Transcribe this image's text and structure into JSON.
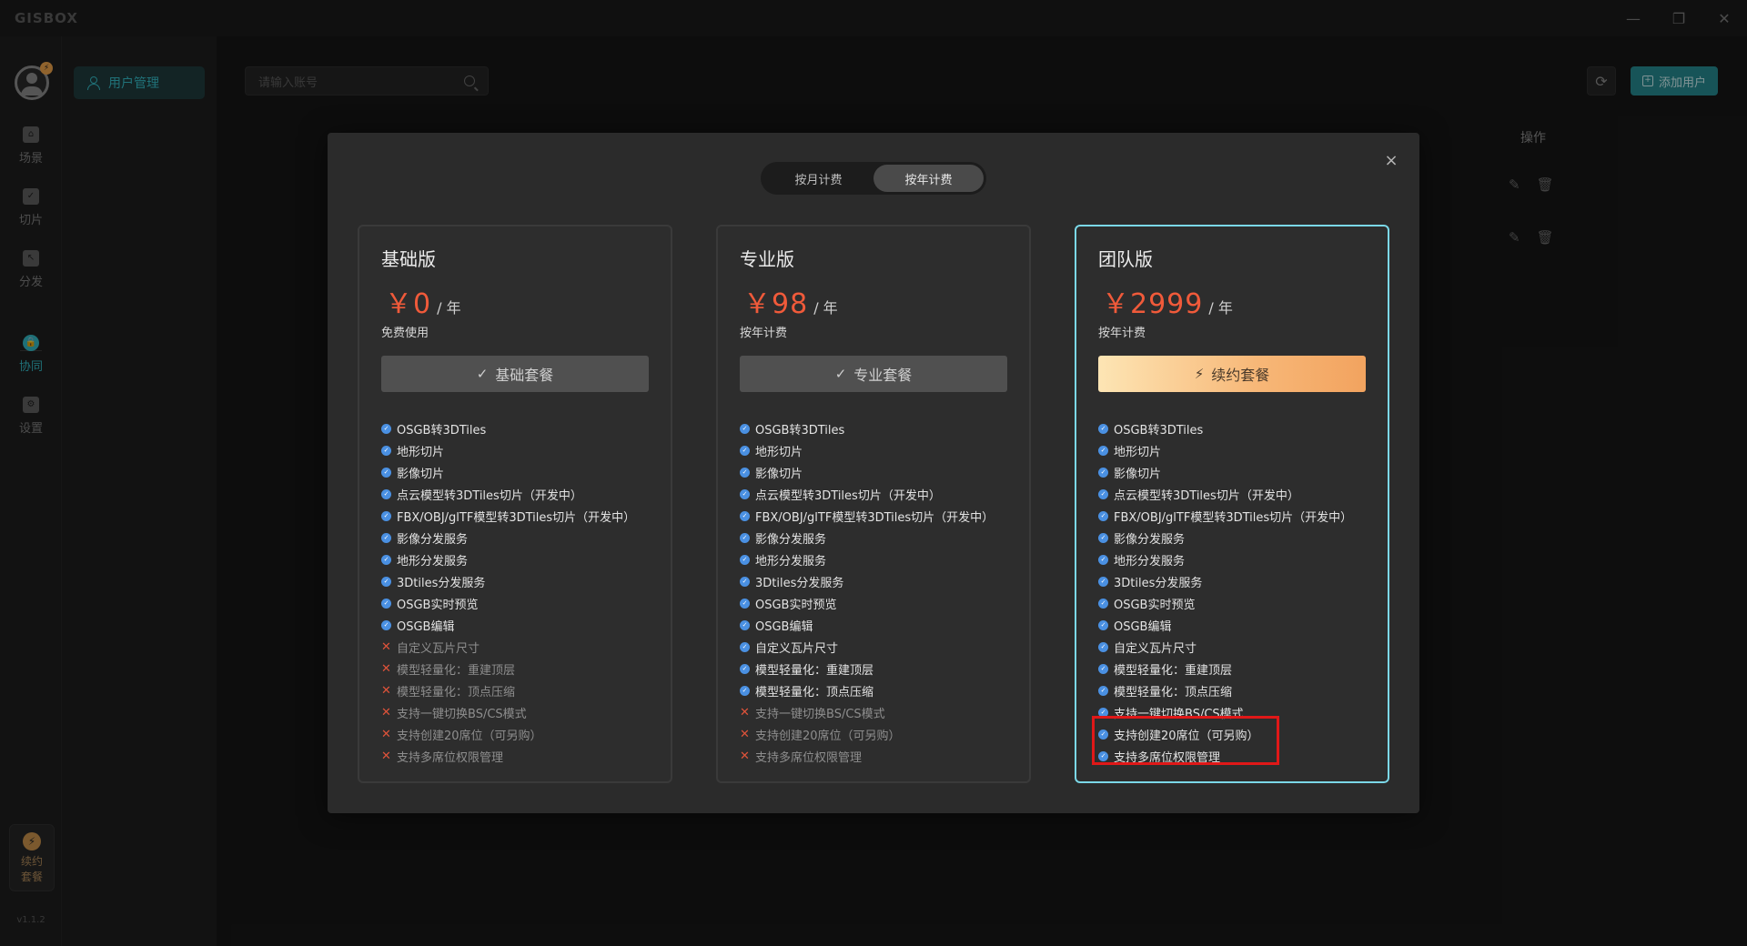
{
  "app": {
    "logo": "GISBOX",
    "version": "v1.1.2"
  },
  "window_controls": {
    "minimize": "—",
    "restore": "❐",
    "close": "✕"
  },
  "rail": {
    "items": [
      {
        "label": "场景",
        "icon": "home-icon"
      },
      {
        "label": "切片",
        "icon": "slice-icon"
      },
      {
        "label": "分发",
        "icon": "distribute-icon"
      },
      {
        "label": "协同",
        "icon": "lock-icon",
        "active": true
      },
      {
        "label": "设置",
        "icon": "gear-icon"
      }
    ],
    "renew": {
      "label_line1": "续约",
      "label_line2": "套餐"
    }
  },
  "subside": {
    "item": "用户管理"
  },
  "toolbar": {
    "search_placeholder": "请输入账号",
    "add_user": "添加用户",
    "refresh": "⟳"
  },
  "table": {
    "actions_header": "操作"
  },
  "modal": {
    "close": "×",
    "billing_toggle": {
      "monthly": "按月计费",
      "yearly": "按年计费",
      "selected": "yearly"
    },
    "plans": [
      {
        "name": "基础版",
        "currency": "￥",
        "price": "0",
        "unit": "/ 年",
        "subtitle": "免费使用",
        "button": "基础套餐",
        "features": [
          {
            "text": "OSGB转3DTiles",
            "ok": true
          },
          {
            "text": "地形切片",
            "ok": true
          },
          {
            "text": "影像切片",
            "ok": true
          },
          {
            "text": "点云模型转3DTiles切片（开发中）",
            "ok": true
          },
          {
            "text": "FBX/OBJ/glTF模型转3DTiles切片（开发中）",
            "ok": true
          },
          {
            "text": "影像分发服务",
            "ok": true
          },
          {
            "text": "地形分发服务",
            "ok": true
          },
          {
            "text": "3Dtiles分发服务",
            "ok": true
          },
          {
            "text": "OSGB实时预览",
            "ok": true
          },
          {
            "text": "OSGB编辑",
            "ok": true
          },
          {
            "text": "自定义瓦片尺寸",
            "ok": false
          },
          {
            "text": "模型轻量化：重建顶层",
            "ok": false
          },
          {
            "text": "模型轻量化：顶点压缩",
            "ok": false
          },
          {
            "text": "支持一键切换BS/CS模式",
            "ok": false
          },
          {
            "text": "支持创建20席位（可另购）",
            "ok": false
          },
          {
            "text": "支持多席位权限管理",
            "ok": false
          }
        ]
      },
      {
        "name": "专业版",
        "currency": "￥",
        "price": "98",
        "unit": "/ 年",
        "subtitle": "按年计费",
        "button": "专业套餐",
        "features": [
          {
            "text": "OSGB转3DTiles",
            "ok": true
          },
          {
            "text": "地形切片",
            "ok": true
          },
          {
            "text": "影像切片",
            "ok": true
          },
          {
            "text": "点云模型转3DTiles切片（开发中）",
            "ok": true
          },
          {
            "text": "FBX/OBJ/glTF模型转3DTiles切片（开发中）",
            "ok": true
          },
          {
            "text": "影像分发服务",
            "ok": true
          },
          {
            "text": "地形分发服务",
            "ok": true
          },
          {
            "text": "3Dtiles分发服务",
            "ok": true
          },
          {
            "text": "OSGB实时预览",
            "ok": true
          },
          {
            "text": "OSGB编辑",
            "ok": true
          },
          {
            "text": "自定义瓦片尺寸",
            "ok": true
          },
          {
            "text": "模型轻量化：重建顶层",
            "ok": true
          },
          {
            "text": "模型轻量化：顶点压缩",
            "ok": true
          },
          {
            "text": "支持一键切换BS/CS模式",
            "ok": false
          },
          {
            "text": "支持创建20席位（可另购）",
            "ok": false
          },
          {
            "text": "支持多席位权限管理",
            "ok": false
          }
        ]
      },
      {
        "name": "团队版",
        "currency": "￥",
        "price": "2999",
        "unit": "/ 年",
        "subtitle": "按年计费",
        "button": "续约套餐",
        "features": [
          {
            "text": "OSGB转3DTiles",
            "ok": true
          },
          {
            "text": "地形切片",
            "ok": true
          },
          {
            "text": "影像切片",
            "ok": true
          },
          {
            "text": "点云模型转3DTiles切片（开发中）",
            "ok": true
          },
          {
            "text": "FBX/OBJ/glTF模型转3DTiles切片（开发中）",
            "ok": true
          },
          {
            "text": "影像分发服务",
            "ok": true
          },
          {
            "text": "地形分发服务",
            "ok": true
          },
          {
            "text": "3Dtiles分发服务",
            "ok": true
          },
          {
            "text": "OSGB实时预览",
            "ok": true
          },
          {
            "text": "OSGB编辑",
            "ok": true
          },
          {
            "text": "自定义瓦片尺寸",
            "ok": true
          },
          {
            "text": "模型轻量化：重建顶层",
            "ok": true
          },
          {
            "text": "模型轻量化：顶点压缩",
            "ok": true
          },
          {
            "text": "支持一键切换BS/CS模式",
            "ok": true
          },
          {
            "text": "支持创建20席位（可另购）",
            "ok": true
          },
          {
            "text": "支持多席位权限管理",
            "ok": true
          }
        ]
      }
    ]
  },
  "colors": {
    "accent": "#33b5c0",
    "price": "#f05a3a",
    "check": "#4a90e2",
    "cross": "#e0533a",
    "highlight_border": "#7bd8e8",
    "annotation": "#e01818"
  }
}
